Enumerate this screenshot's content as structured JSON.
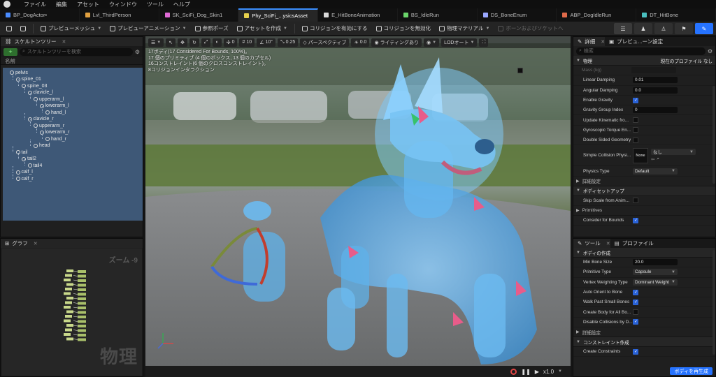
{
  "menubar": {
    "items": [
      "ファイル",
      "編集",
      "アセット",
      "ウィンドウ",
      "ツール",
      "ヘルプ"
    ]
  },
  "tabs": [
    {
      "label": "BP_DogActor•",
      "color": "#4a8cff",
      "active": false
    },
    {
      "label": "Lvl_ThirdPerson",
      "color": "#e0a040",
      "active": false
    },
    {
      "label": "SK_SciFi_Dog_Skin1",
      "color": "#e06ad6",
      "active": false
    },
    {
      "label": "Phy_SciFi_...ysicsAsset",
      "color": "#e6d04c",
      "active": true
    },
    {
      "label": "E_HitBoneAnimation",
      "color": "#d9d9d9",
      "active": false
    },
    {
      "label": "BS_IdleRun",
      "color": "#6bd66b",
      "active": false
    },
    {
      "label": "DS_BoneEnum",
      "color": "#9ba8ff",
      "active": false
    },
    {
      "label": "ABP_DogIdleRun",
      "color": "#e06a4a",
      "active": false
    },
    {
      "label": "DT_HitBone",
      "color": "#4ac0c0",
      "active": false
    }
  ],
  "toolbar": {
    "preview_mesh": "プレビューメッシュ",
    "preview_anim": "プレビューアニメーション",
    "ref_pose": "参照ポーズ",
    "create_asset": "アセットを作成",
    "enable_collision": "コリジョンを有効にする",
    "disable_collision": "コリジョンを無効化",
    "physics_material": "物理マテリアル",
    "bones_sockets": "ボーンおよびソケットへ"
  },
  "skeleton_panel": {
    "tab": "スケルトンツリー",
    "search_placeholder": "スケルトンツリーを検索",
    "header": "名前",
    "bones": [
      {
        "name": "pelvis",
        "depth": 0
      },
      {
        "name": "spine_01",
        "depth": 1
      },
      {
        "name": "spine_03",
        "depth": 2
      },
      {
        "name": "clavicle_l",
        "depth": 3
      },
      {
        "name": "upperarm_l",
        "depth": 4
      },
      {
        "name": "lowerarm_l",
        "depth": 5
      },
      {
        "name": "hand_l",
        "depth": 6
      },
      {
        "name": "clavicle_r",
        "depth": 3
      },
      {
        "name": "upperarm_r",
        "depth": 4
      },
      {
        "name": "lowerarm_r",
        "depth": 5
      },
      {
        "name": "hand_r",
        "depth": 6
      },
      {
        "name": "head",
        "depth": 4
      },
      {
        "name": "tail",
        "depth": 1
      },
      {
        "name": "tail2",
        "depth": 2
      },
      {
        "name": "tail4",
        "depth": 3
      },
      {
        "name": "calf_l",
        "depth": 1
      },
      {
        "name": "calf_r",
        "depth": 1
      }
    ]
  },
  "graph_panel": {
    "tab": "グラフ",
    "zoom": "ズーム -9",
    "watermark": "物理"
  },
  "viewport": {
    "perspective": "パースペクティブ",
    "lighting": "ライティングあり",
    "lod": "LODオート",
    "snap_move": "10",
    "snap_rotate": "10°",
    "snap_scale": "0.25",
    "speed_a": "0",
    "speed_b": "0.0",
    "stats": [
      "17ボディ(17 Considered For Bounds, 100%)。",
      "17 個のプリミティブ (4 個のボックス, 13 個のカプセル)",
      "16コンストレイント(6 個のクロスコンストレイント)。",
      "8コリジョンインタラクション"
    ],
    "playback_speed": "x1.0"
  },
  "details_panel": {
    "tab": "詳細",
    "tab2": "プレビュ...ーン設定",
    "search_placeholder": "検索",
    "section_physics": "物理",
    "profile_label": "現在のプロファイル",
    "profile_value": "なし",
    "props": [
      {
        "name": "Mass (kg)",
        "type": "num",
        "value": "",
        "disabled": true
      },
      {
        "name": "Linear Damping",
        "type": "num",
        "value": "0.01"
      },
      {
        "name": "Angular Damping",
        "type": "num",
        "value": "0.0"
      },
      {
        "name": "Enable Gravity",
        "type": "chk",
        "value": true
      },
      {
        "name": "Gravity Group Index",
        "type": "num",
        "value": "0"
      },
      {
        "name": "Update Kinematic fro...",
        "type": "chk",
        "value": false
      },
      {
        "name": "Gyroscopic Torque En...",
        "type": "chk",
        "value": false
      },
      {
        "name": "Double Sided Geometry",
        "type": "chk",
        "value": false
      }
    ],
    "simple_collision": {
      "name": "Simple Collision Physi...",
      "thumb": "None",
      "value": "なし"
    },
    "physics_type": {
      "name": "Physics Type",
      "value": "Default"
    },
    "advanced": "詳細設定",
    "body_setup": "ボディセットアップ",
    "body_props": [
      {
        "name": "Skip Scale from Anim...",
        "value": false
      },
      {
        "name": "Primitives",
        "section": true
      },
      {
        "name": "Consider for Bounds",
        "value": true
      }
    ]
  },
  "tools_panel": {
    "tab": "ツール",
    "tab2": "プロファイル",
    "section_body": "ボディの作成",
    "props": [
      {
        "name": "Min Bone Size",
        "type": "num",
        "value": "20.0"
      },
      {
        "name": "Primitive Type",
        "type": "drop",
        "value": "Capsule"
      },
      {
        "name": "Vertex Weighting Type",
        "type": "drop",
        "value": "Dominant Weight"
      },
      {
        "name": "Auto Orient to Bone",
        "type": "chk",
        "value": true
      },
      {
        "name": "Walk Past Small Bones",
        "type": "chk",
        "value": true
      },
      {
        "name": "Create Body for All Bo...",
        "type": "chk",
        "value": false
      },
      {
        "name": "Disable Collisions by D...",
        "type": "chk",
        "value": true
      }
    ],
    "advanced": "詳細設定",
    "section_constraint": "コンストレイント作成",
    "create_constraints": {
      "name": "Create Constraints",
      "value": true
    },
    "regenerate": "ボディを再生成"
  },
  "colors": {
    "accent": "#2673ff",
    "selection": "#3e5877"
  }
}
